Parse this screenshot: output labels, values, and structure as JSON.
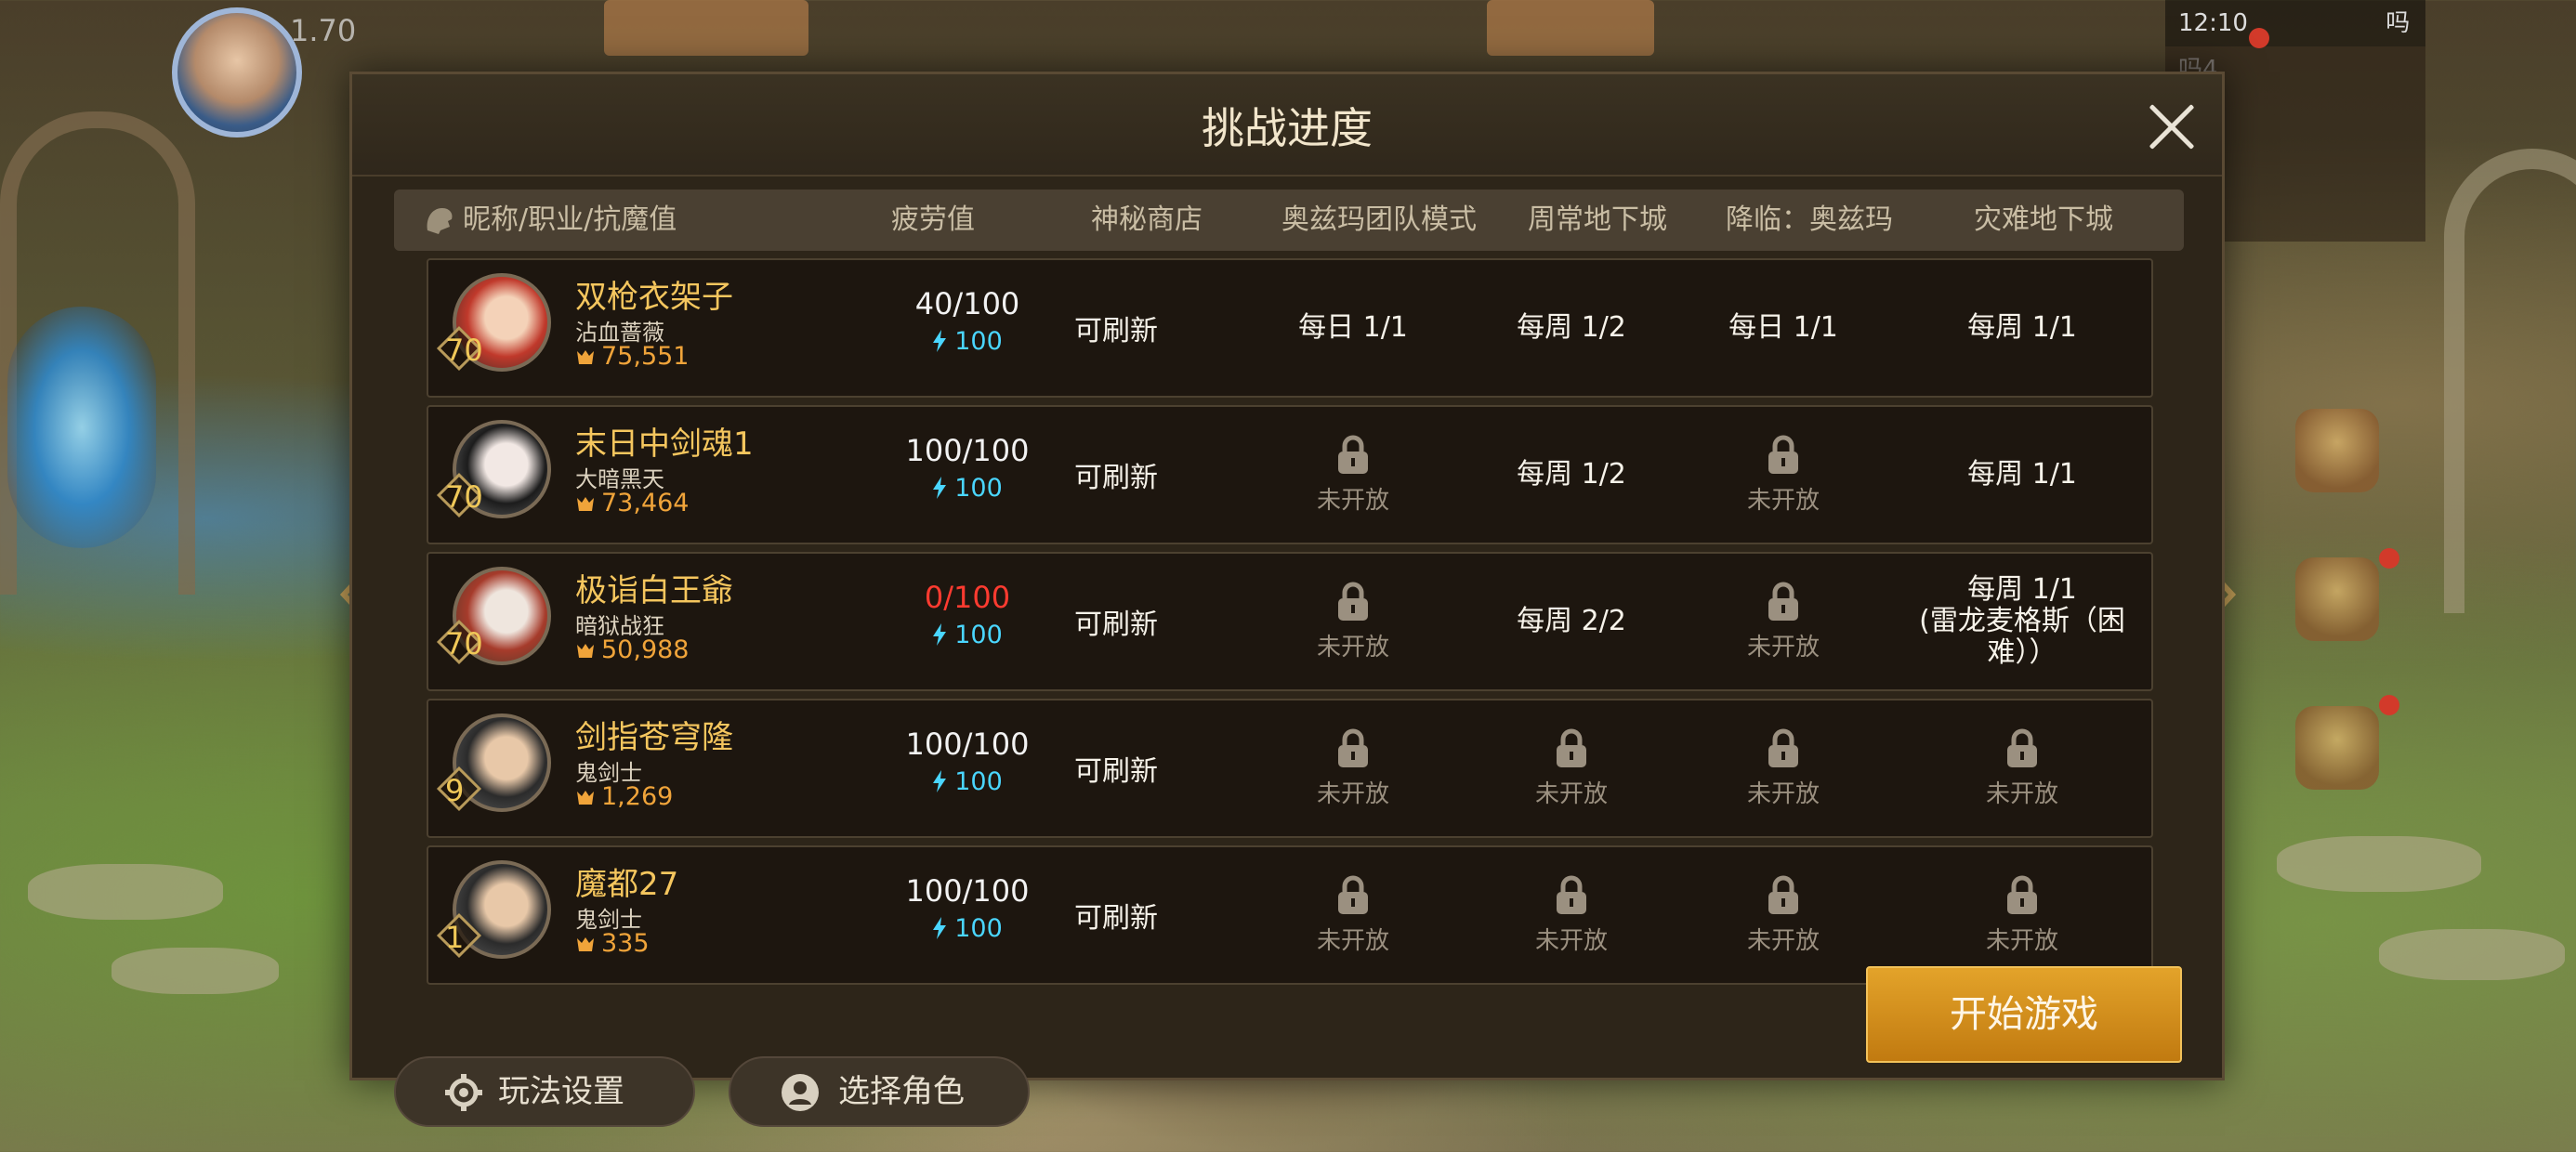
{
  "background": {
    "top_player_level": "1.70",
    "status_time": "12:10",
    "status_right": "吗吗4"
  },
  "dialog": {
    "title": "挑战进度",
    "columns": [
      "昵称/职业/抗魔值",
      "疲劳值",
      "神秘商店",
      "奥兹玛团队模式",
      "周常地下城",
      "降临：奥兹玛",
      "灾难地下城"
    ],
    "characters": [
      {
        "level": "70",
        "name": "双枪衣架子",
        "class": "沾血蔷薇",
        "power": "75,551",
        "fatigue": "40/100",
        "fatigue_empty": false,
        "energy": "100",
        "shop": "可刷新",
        "ozma_raid": {
          "locked": false,
          "text": "每日 1/1"
        },
        "weekly_dungeon": {
          "locked": false,
          "text": "每周 1/2"
        },
        "ozma_descent": {
          "locked": false,
          "text": "每日 1/1"
        },
        "disaster_dungeon": {
          "locked": false,
          "text": "每周 1/1"
        }
      },
      {
        "level": "70",
        "name": "末日中剑魂1",
        "class": "大暗黑天",
        "power": "73,464",
        "fatigue": "100/100",
        "fatigue_empty": false,
        "energy": "100",
        "shop": "可刷新",
        "ozma_raid": {
          "locked": true,
          "text": "未开放"
        },
        "weekly_dungeon": {
          "locked": false,
          "text": "每周 1/2"
        },
        "ozma_descent": {
          "locked": true,
          "text": "未开放"
        },
        "disaster_dungeon": {
          "locked": false,
          "text": "每周 1/1"
        }
      },
      {
        "level": "70",
        "name": "极诣白王爺",
        "class": "暗狱战狂",
        "power": "50,988",
        "fatigue": "0/100",
        "fatigue_empty": true,
        "energy": "100",
        "shop": "可刷新",
        "ozma_raid": {
          "locked": true,
          "text": "未开放"
        },
        "weekly_dungeon": {
          "locked": false,
          "text": "每周 2/2"
        },
        "ozma_descent": {
          "locked": true,
          "text": "未开放"
        },
        "disaster_dungeon": {
          "locked": false,
          "text": "每周 1/1",
          "detail": "(雷龙麦格斯（困难））"
        }
      },
      {
        "level": "9",
        "name": "剑指苍穹隆",
        "class": "鬼剑士",
        "power": "1,269",
        "fatigue": "100/100",
        "fatigue_empty": false,
        "energy": "100",
        "shop": "可刷新",
        "ozma_raid": {
          "locked": true,
          "text": "未开放"
        },
        "weekly_dungeon": {
          "locked": true,
          "text": "未开放"
        },
        "ozma_descent": {
          "locked": true,
          "text": "未开放"
        },
        "disaster_dungeon": {
          "locked": true,
          "text": "未开放"
        }
      },
      {
        "level": "1",
        "name": "魔都27",
        "class": "鬼剑士",
        "power": "335",
        "fatigue": "100/100",
        "fatigue_empty": false,
        "energy": "100",
        "shop": "可刷新",
        "ozma_raid": {
          "locked": true,
          "text": "未开放"
        },
        "weekly_dungeon": {
          "locked": true,
          "text": "未开放"
        },
        "ozma_descent": {
          "locked": true,
          "text": "未开放"
        },
        "disaster_dungeon": {
          "locked": true,
          "text": "未开放"
        }
      }
    ],
    "buttons": {
      "settings": "玩法设置",
      "select_character": "选择角色",
      "start": "开始游戏"
    }
  },
  "colors": {
    "name": "#f5c65e",
    "power": "#f0a43a",
    "energy": "#4ad6ff",
    "fatigue_empty": "#ff3b30",
    "start_button": "#e3a32a",
    "panel": "#2d2519"
  },
  "icons": {
    "close": "close-icon",
    "lock": "lock-icon",
    "energy": "lightning-icon",
    "power": "demon-mask-icon",
    "settings": "gear-icon",
    "select": "character-swap-icon"
  }
}
